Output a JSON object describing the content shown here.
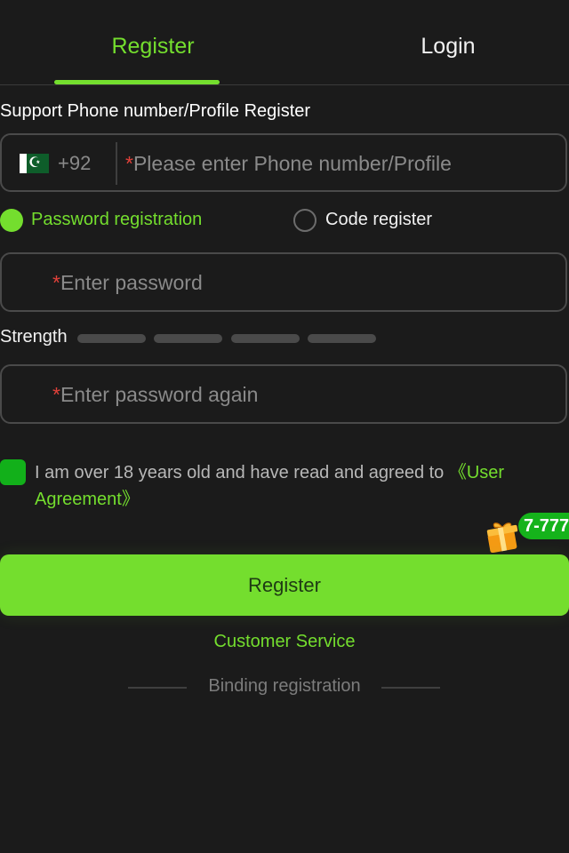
{
  "tabs": [
    {
      "label": "Register",
      "active": true
    },
    {
      "label": "Login",
      "active": false
    }
  ],
  "form": {
    "section_label": "Support Phone number/Profile Register",
    "phone": {
      "flag_icon": "pakistan-flag-icon",
      "dial_code": "+92",
      "required_mark": "*",
      "placeholder": "Please enter Phone number/Profile"
    },
    "mode": {
      "options": [
        {
          "label": "Password registration",
          "selected": true
        },
        {
          "label": "Code register",
          "selected": false
        }
      ]
    },
    "password": {
      "required_mark": "*",
      "placeholder": "Enter password"
    },
    "strength": {
      "label": "Strength",
      "level": 0,
      "segments": 4
    },
    "password_again": {
      "required_mark": "*",
      "placeholder": "Enter password again"
    },
    "agreement": {
      "checked": true,
      "text": "I am over 18 years old and have read and agreed to ",
      "link": "《User Agreement》"
    }
  },
  "promo": {
    "icon": "gift-icon",
    "badge": "7-777"
  },
  "actions": {
    "register": "Register",
    "customer_service": "Customer Service",
    "binding": "Binding registration"
  },
  "colors": {
    "accent": "#74de2e",
    "background": "#1b1b1b",
    "required": "#e0413a",
    "checkbox": "#12b01a"
  }
}
